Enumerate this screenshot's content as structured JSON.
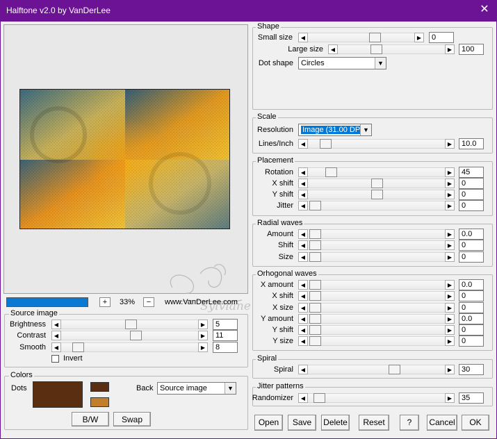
{
  "window": {
    "title": "Halftone v2.0 by VanDerLee"
  },
  "preview": {
    "zoom": "33%",
    "website": "www.VanDerLee.com",
    "watermark": "Sylviane",
    "zoom_plus": "+",
    "zoom_minus": "−"
  },
  "source_image": {
    "title": "Source image",
    "brightness": {
      "label": "Brightness",
      "value": "5"
    },
    "contrast": {
      "label": "Contrast",
      "value": "11"
    },
    "smooth": {
      "label": "Smooth",
      "value": "8"
    },
    "invert_label": "Invert"
  },
  "colors": {
    "title": "Colors",
    "dots_label": "Dots",
    "back_label": "Back",
    "back_value": "Source image",
    "dots_color": "#5a2e10",
    "swatch_a": "#5a2e10",
    "swatch_b": "#c17f2c",
    "bw_label": "B/W",
    "swap_label": "Swap"
  },
  "shape": {
    "title": "Shape",
    "small_size": {
      "label": "Small size",
      "value": "0"
    },
    "large_size": {
      "label": "Large size",
      "value": "100"
    },
    "dot_shape": {
      "label": "Dot shape",
      "value": "Circles"
    }
  },
  "scale": {
    "title": "Scale",
    "resolution": {
      "label": "Resolution",
      "value": "Image (31.00 DPI"
    },
    "lines_inch": {
      "label": "Lines/Inch",
      "value": "10.0"
    }
  },
  "placement": {
    "title": "Placement",
    "rotation": {
      "label": "Rotation",
      "value": "45"
    },
    "x_shift": {
      "label": "X shift",
      "value": "0"
    },
    "y_shift": {
      "label": "Y shift",
      "value": "0"
    },
    "jitter": {
      "label": "Jitter",
      "value": "0"
    }
  },
  "radial": {
    "title": "Radial waves",
    "amount": {
      "label": "Amount",
      "value": "0.0"
    },
    "shift": {
      "label": "Shift",
      "value": "0"
    },
    "size": {
      "label": "Size",
      "value": "0"
    }
  },
  "orthogonal": {
    "title": "Orhogonal waves",
    "x_amount": {
      "label": "X amount",
      "value": "0.0"
    },
    "x_shift": {
      "label": "X shift",
      "value": "0"
    },
    "x_size": {
      "label": "X size",
      "value": "0"
    },
    "y_amount": {
      "label": "Y amount",
      "value": "0.0"
    },
    "y_shift": {
      "label": "Y shift",
      "value": "0"
    },
    "y_size": {
      "label": "Y size",
      "value": "0"
    }
  },
  "spiral": {
    "title": "Spiral",
    "label": "Spiral",
    "value": "30"
  },
  "jitter_patterns": {
    "title": "Jitter patterns",
    "label": "Randomizer",
    "value": "35"
  },
  "buttons": {
    "open": "Open",
    "save": "Save",
    "delete": "Delete",
    "reset": "Reset",
    "help": "?",
    "cancel": "Cancel",
    "ok": "OK"
  }
}
